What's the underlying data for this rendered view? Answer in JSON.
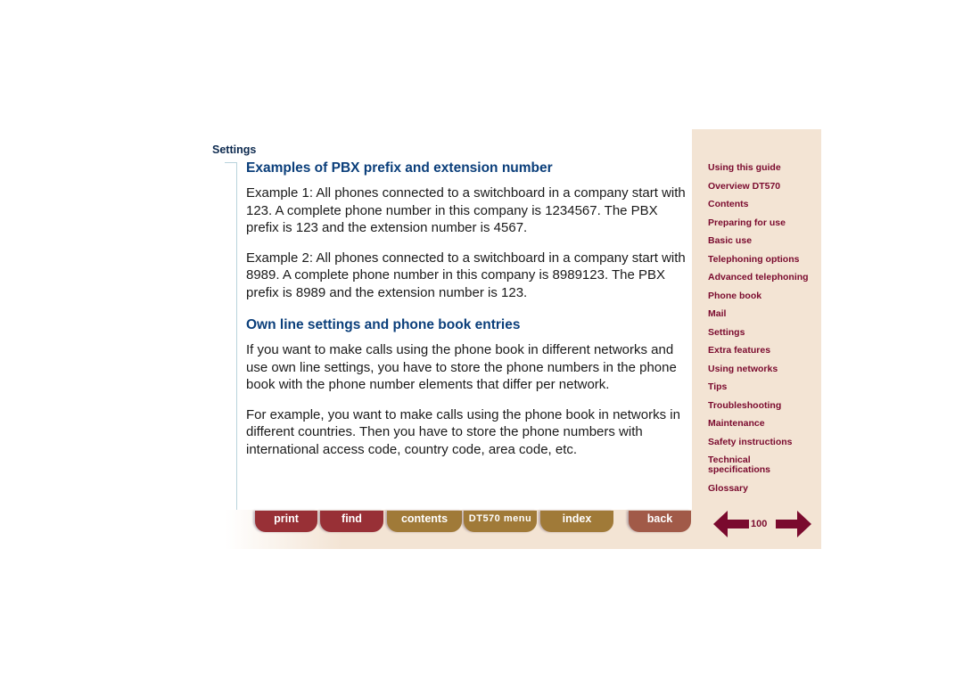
{
  "section_label": "Settings",
  "content": {
    "heading1": "Examples of PBX prefix and extension number",
    "para1": "Example 1: All phones connected to a switchboard in a company start with 123. A complete phone number in this company is 1234567. The PBX prefix is 123 and the extension number is 4567.",
    "para2": "Example 2: All phones connected to a switchboard in a company start with 8989. A complete phone number in this company is 8989123. The PBX prefix is 8989 and the extension number is 123.",
    "heading2": "Own line settings and phone book entries",
    "para3": "If you want to make calls using the phone book in different networks and use own line settings, you have to store the phone numbers in the phone book with the phone number elements that differ per network.",
    "para4": "For example, you want to make calls using the phone book in networks in different countries. Then you have to store the phone numbers with international access code, country code, area code, etc."
  },
  "sidebar": {
    "items": [
      {
        "label": "Using this guide"
      },
      {
        "label": "Overview DT570"
      },
      {
        "label": "Contents"
      },
      {
        "label": "Preparing for use"
      },
      {
        "label": "Basic use"
      },
      {
        "label": "Telephoning options"
      },
      {
        "label": "Advanced telephoning"
      },
      {
        "label": "Phone book"
      },
      {
        "label": "Mail"
      },
      {
        "label": "Settings"
      },
      {
        "label": "Extra features"
      },
      {
        "label": "Using networks"
      },
      {
        "label": "Tips"
      },
      {
        "label": "Troubleshooting"
      },
      {
        "label": "Maintenance"
      },
      {
        "label": "Safety instructions"
      },
      {
        "label": "Technical specifications"
      },
      {
        "label": "Glossary"
      }
    ]
  },
  "toolbar": {
    "print": "print",
    "find": "find",
    "contents": "contents",
    "menu": "DT570 menu",
    "index": "index",
    "back": "back"
  },
  "pager": {
    "page_number": "100",
    "prev_icon": "arrow-left-icon",
    "next_icon": "arrow-right-icon",
    "color": "#7a0a2e"
  }
}
